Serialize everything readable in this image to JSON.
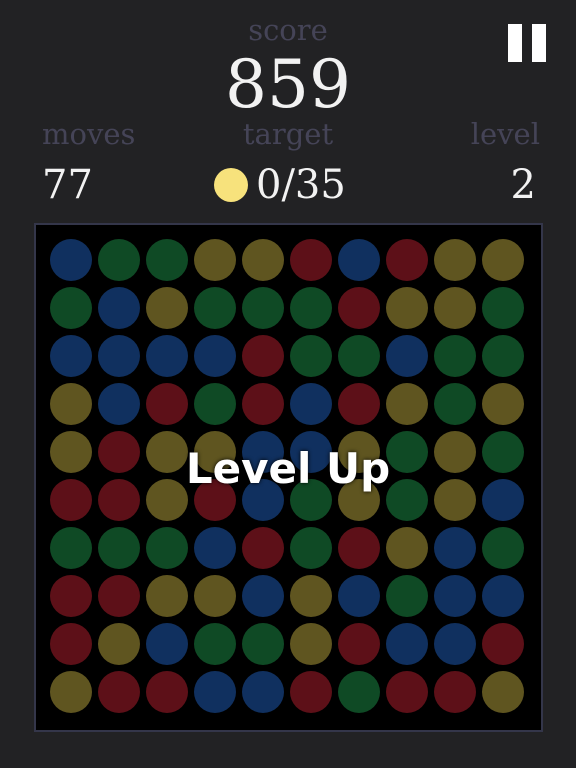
{
  "hud": {
    "score_label": "score",
    "score_value": "859",
    "moves_label": "moves",
    "moves_value": "77",
    "target_label": "target",
    "target_value": "0/35",
    "target_color": "#f7e27c",
    "level_label": "level",
    "level_value": "2"
  },
  "controls": {
    "pause_icon": "pause-icon"
  },
  "overlay": {
    "text": "Level Up"
  },
  "colors": {
    "blue": "#10305f",
    "green": "#0f4a25",
    "yellow": "#5f5520",
    "red": "#5d1018"
  },
  "board": {
    "rows": [
      [
        "blue",
        "green",
        "green",
        "yellow",
        "yellow",
        "red",
        "blue",
        "red",
        "yellow",
        "yellow"
      ],
      [
        "green",
        "blue",
        "yellow",
        "green",
        "green",
        "green",
        "red",
        "yellow",
        "yellow",
        "green"
      ],
      [
        "blue",
        "blue",
        "blue",
        "blue",
        "red",
        "green",
        "green",
        "blue",
        "green",
        "green"
      ],
      [
        "yellow",
        "blue",
        "red",
        "green",
        "red",
        "blue",
        "red",
        "yellow",
        "green",
        "yellow"
      ],
      [
        "yellow",
        "red",
        "yellow",
        "yellow",
        "blue",
        "blue",
        "yellow",
        "green",
        "yellow",
        "green"
      ],
      [
        "red",
        "red",
        "yellow",
        "red",
        "blue",
        "green",
        "yellow",
        "green",
        "yellow",
        "blue"
      ],
      [
        "green",
        "green",
        "green",
        "blue",
        "red",
        "green",
        "red",
        "yellow",
        "blue",
        "green"
      ],
      [
        "red",
        "red",
        "yellow",
        "yellow",
        "blue",
        "yellow",
        "blue",
        "green",
        "blue",
        "blue"
      ],
      [
        "red",
        "yellow",
        "blue",
        "green",
        "green",
        "yellow",
        "red",
        "blue",
        "blue",
        "red"
      ],
      [
        "yellow",
        "red",
        "red",
        "blue",
        "blue",
        "red",
        "green",
        "red",
        "red",
        "yellow"
      ]
    ]
  }
}
